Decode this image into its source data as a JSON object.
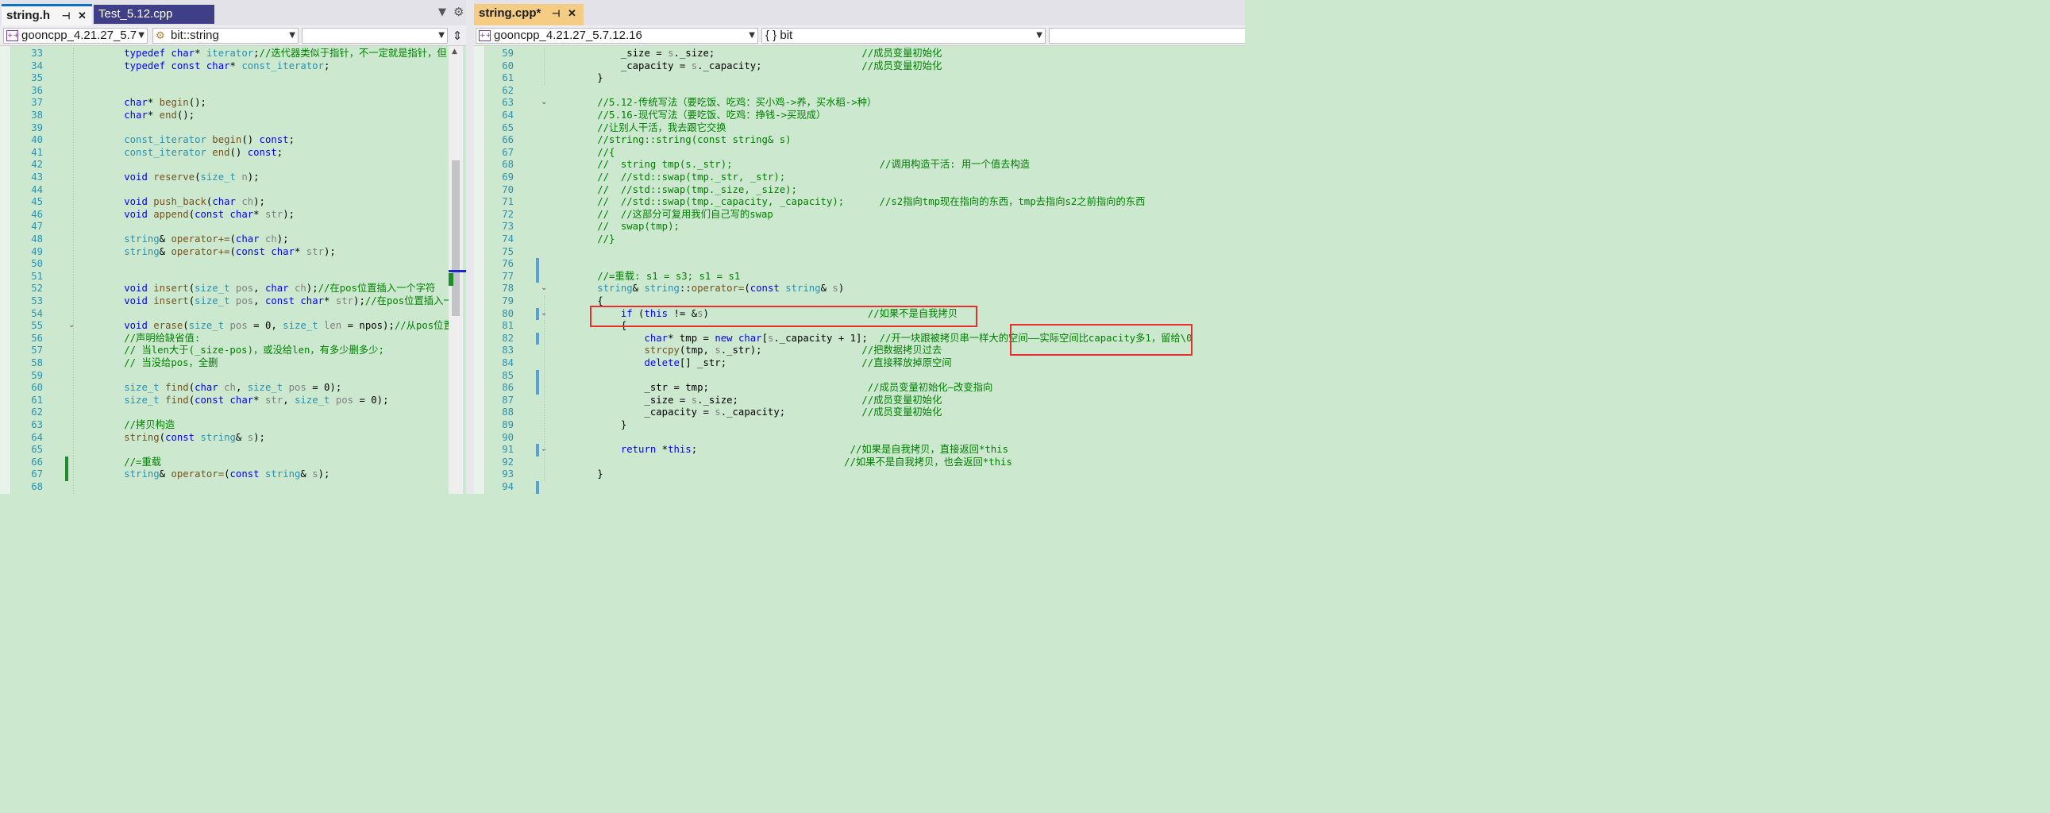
{
  "left_pane": {
    "tabs": [
      {
        "label": "string.h",
        "active": true
      },
      {
        "label": "Test_5.12.cpp",
        "active": false
      }
    ],
    "nav": {
      "project": "gooncpp_4.21.27_5.7",
      "scope": "bit::string",
      "member": ""
    },
    "lines": [
      {
        "n": "33",
        "html": "        <span class=\"kw\">typedef</span> <span class=\"kw\">char</span>* <span class=\"ty\">iterator</span>;<span class=\"cm\">//迭代器类似于指针，不一定就是指针，但</span>"
      },
      {
        "n": "34",
        "html": "        <span class=\"kw\">typedef</span> <span class=\"kw\">const</span> <span class=\"kw\">char</span>* <span class=\"ty\">const_iterator</span>;"
      },
      {
        "n": "35",
        "html": ""
      },
      {
        "n": "36",
        "html": ""
      },
      {
        "n": "37",
        "html": "        <span class=\"kw\">char</span>* <span class=\"fn\">begin</span>();"
      },
      {
        "n": "38",
        "html": "        <span class=\"kw\">char</span>* <span class=\"fn\">end</span>();"
      },
      {
        "n": "39",
        "html": ""
      },
      {
        "n": "40",
        "html": "        <span class=\"ty\">const_iterator</span> <span class=\"fn\">begin</span>() <span class=\"kw\">const</span>;"
      },
      {
        "n": "41",
        "html": "        <span class=\"ty\">const_iterator</span> <span class=\"fn\">end</span>() <span class=\"kw\">const</span>;"
      },
      {
        "n": "42",
        "html": ""
      },
      {
        "n": "43",
        "html": "        <span class=\"kw\">void</span> <span class=\"fn\">reserve</span>(<span class=\"ty\">size_t</span> <span class=\"pm\">n</span>);"
      },
      {
        "n": "44",
        "html": ""
      },
      {
        "n": "45",
        "html": "        <span class=\"kw\">void</span> <span class=\"fn\">push_back</span>(<span class=\"kw\">char</span> <span class=\"pm\">ch</span>);"
      },
      {
        "n": "46",
        "html": "        <span class=\"kw\">void</span> <span class=\"fn\">append</span>(<span class=\"kw\">const</span> <span class=\"kw\">char</span>* <span class=\"pm\">str</span>);"
      },
      {
        "n": "47",
        "html": ""
      },
      {
        "n": "48",
        "html": "        <span class=\"ty\">string</span>&amp; <span class=\"fn\">operator+=</span>(<span class=\"kw\">char</span> <span class=\"pm\">ch</span>);"
      },
      {
        "n": "49",
        "html": "        <span class=\"ty\">string</span>&amp; <span class=\"fn\">operator+=</span>(<span class=\"kw\">const</span> <span class=\"kw\">char</span>* <span class=\"pm\">str</span>);"
      },
      {
        "n": "50",
        "html": ""
      },
      {
        "n": "51",
        "html": ""
      },
      {
        "n": "52",
        "html": "        <span class=\"kw\">void</span> <span class=\"fn\">insert</span>(<span class=\"ty\">size_t</span> <span class=\"pm\">pos</span>, <span class=\"kw\">char</span> <span class=\"pm\">ch</span>);<span class=\"cm\">//在pos位置插入一个字符</span>"
      },
      {
        "n": "53",
        "html": "        <span class=\"kw\">void</span> <span class=\"fn\">insert</span>(<span class=\"ty\">size_t</span> <span class=\"pm\">pos</span>, <span class=\"kw\">const</span> <span class=\"kw\">char</span>* <span class=\"pm\">str</span>);<span class=\"cm\">//在pos位置插入一</span>"
      },
      {
        "n": "54",
        "html": ""
      },
      {
        "n": "55",
        "html": "        <span class=\"kw\">void</span> <span class=\"fn\">erase</span>(<span class=\"ty\">size_t</span> <span class=\"pm\">pos</span> = 0, <span class=\"ty\">size_t</span> <span class=\"pm\">len</span> = npos);<span class=\"cm\">//从pos位置</span>"
      },
      {
        "n": "56",
        "html": "        <span class=\"cm\">//声明给缺省值:</span>"
      },
      {
        "n": "57",
        "html": "        <span class=\"cm\">// 当len大于(_size-pos)，或没给len，有多少删多少;</span>"
      },
      {
        "n": "58",
        "html": "        <span class=\"cm\">// 当没给pos，全删</span>"
      },
      {
        "n": "59",
        "html": ""
      },
      {
        "n": "60",
        "html": "        <span class=\"ty\">size_t</span> <span class=\"fn\">find</span>(<span class=\"kw\">char</span> <span class=\"pm\">ch</span>, <span class=\"ty\">size_t</span> <span class=\"pm\">pos</span> = 0);"
      },
      {
        "n": "61",
        "html": "        <span class=\"ty\">size_t</span> <span class=\"fn\">find</span>(<span class=\"kw\">const</span> <span class=\"kw\">char</span>* <span class=\"pm\">str</span>, <span class=\"ty\">size_t</span> <span class=\"pm\">pos</span> = 0);"
      },
      {
        "n": "62",
        "html": ""
      },
      {
        "n": "63",
        "html": "        <span class=\"cm\">//拷贝构造</span>"
      },
      {
        "n": "64",
        "html": "        <span class=\"fn\">string</span>(<span class=\"kw\">const</span> <span class=\"ty\">string</span>&amp; <span class=\"pm\">s</span>);"
      },
      {
        "n": "65",
        "html": ""
      },
      {
        "n": "66",
        "html": "        <span class=\"cm\">//=重载</span>"
      },
      {
        "n": "67",
        "html": "        <span class=\"ty\">string</span>&amp; <span class=\"fn\">operator=</span>(<span class=\"kw\">const</span> <span class=\"ty\">string</span>&amp; <span class=\"pm\">s</span>);"
      },
      {
        "n": "68",
        "html": ""
      }
    ]
  },
  "right_pane": {
    "tabs": [
      {
        "label": "string.cpp*",
        "active": true
      }
    ],
    "nav": {
      "project": "gooncpp_4.21.27_5.7.12.16",
      "scope": "{ } bit",
      "member": ""
    },
    "lines": [
      {
        "n": "59",
        "html": "            _size = <span class=\"pm\">s</span>._size;                         <span class=\"cm\">//成员变量初始化</span>"
      },
      {
        "n": "60",
        "html": "            _capacity = <span class=\"pm\">s</span>._capacity;                 <span class=\"cm\">//成员变量初始化</span>"
      },
      {
        "n": "61",
        "html": "        }"
      },
      {
        "n": "62",
        "html": ""
      },
      {
        "n": "63",
        "html": "        <span class=\"cm\">//5.12-传统写法（要吃饭、吃鸡：买小鸡->养，买水稻->种）</span>"
      },
      {
        "n": "64",
        "html": "        <span class=\"cm\">//5.16-现代写法（要吃饭、吃鸡：挣钱->买现成）</span>"
      },
      {
        "n": "65",
        "html": "        <span class=\"cm\">//让别人干活，我去跟它交换</span>"
      },
      {
        "n": "66",
        "html": "        <span class=\"cm\">//string::string(const string& s)</span>"
      },
      {
        "n": "67",
        "html": "        <span class=\"cm\">//{</span>"
      },
      {
        "n": "68",
        "html": "        <span class=\"cm\">//  string tmp(s._str);                         //调用构造干活: 用一个值去构造</span>"
      },
      {
        "n": "69",
        "html": "        <span class=\"cm\">//  //std::swap(tmp._str, _str);</span>"
      },
      {
        "n": "70",
        "html": "        <span class=\"cm\">//  //std::swap(tmp._size, _size);</span>"
      },
      {
        "n": "71",
        "html": "        <span class=\"cm\">//  //std::swap(tmp._capacity, _capacity);      //s2指向tmp现在指向的东西，tmp去指向s2之前指向的东西</span>"
      },
      {
        "n": "72",
        "html": "        <span class=\"cm\">//  //这部分可复用我们自己写的swap</span>"
      },
      {
        "n": "73",
        "html": "        <span class=\"cm\">//  swap(tmp);</span>"
      },
      {
        "n": "74",
        "html": "        <span class=\"cm\">//}</span>"
      },
      {
        "n": "75",
        "html": ""
      },
      {
        "n": "76",
        "html": ""
      },
      {
        "n": "77",
        "html": "        <span class=\"cm\">//=重载: s1 = s3; s1 = s1</span>"
      },
      {
        "n": "78",
        "html": "        <span class=\"ty\">string</span>&amp; <span class=\"ty\">string</span>::<span class=\"fn\">operator=</span>(<span class=\"kw\">const</span> <span class=\"ty\">string</span>&amp; <span class=\"pm\">s</span>)"
      },
      {
        "n": "79",
        "html": "        {"
      },
      {
        "n": "80",
        "html": "            <span class=\"kw\">if</span> (<span class=\"kw\">this</span> != &amp;<span class=\"pm\">s</span>)                           <span class=\"cm\">//如果不是自我拷贝</span>"
      },
      {
        "n": "81",
        "html": "            {"
      },
      {
        "n": "82",
        "html": "                <span class=\"kw\">char</span>* tmp = <span class=\"kw\">new</span> <span class=\"kw\">char</span>[<span class=\"pm\">s</span>._capacity + 1];  <span class=\"cm\">//开一块跟被拷贝串一样大的空间——实际空间比capacity多1，留给\\0</span>"
      },
      {
        "n": "83",
        "html": "                <span class=\"fn\">strcpy</span>(tmp, <span class=\"pm\">s</span>._str);                 <span class=\"cm\">//把数据拷贝过去</span>"
      },
      {
        "n": "84",
        "html": "                <span class=\"kw\">delete</span>[] _str;                       <span class=\"cm\">//直接释放掉原空间</span>"
      },
      {
        "n": "85",
        "html": ""
      },
      {
        "n": "86",
        "html": "                _str = tmp;                           <span class=\"cm\">//成员变量初始化—改变指向</span>"
      },
      {
        "n": "87",
        "html": "                _size = <span class=\"pm\">s</span>._size;                     <span class=\"cm\">//成员变量初始化</span>"
      },
      {
        "n": "88",
        "html": "                _capacity = <span class=\"pm\">s</span>._capacity;             <span class=\"cm\">//成员变量初始化</span>"
      },
      {
        "n": "89",
        "html": "            }"
      },
      {
        "n": "90",
        "html": ""
      },
      {
        "n": "91",
        "html": "            <span class=\"kw\">return</span> *<span class=\"kw\">this</span>;                          <span class=\"cm\">//如果是自我拷贝，直接返回*this</span>"
      },
      {
        "n": "92",
        "html": "                                                  <span class=\"cm\">//如果不是自我拷贝，也会返回*this</span>"
      },
      {
        "n": "93",
        "html": "        }"
      },
      {
        "n": "94",
        "html": ""
      }
    ]
  },
  "icons": {
    "pin": "pin-icon",
    "close": "close-icon",
    "dropdown": "chevron-down-icon",
    "settings": "gear-icon",
    "split": "split-editor-icon",
    "project": "cpp-project-icon",
    "class": "class-scope-icon"
  },
  "colors": {
    "editor_bg": "#cce8cf",
    "keyword": "#0000ff",
    "type": "#2b91af",
    "comment": "#008000",
    "highlight_box": "#e53030",
    "tab_active_right": "#f5cc84",
    "tab_inactive": "#3f3f87"
  }
}
